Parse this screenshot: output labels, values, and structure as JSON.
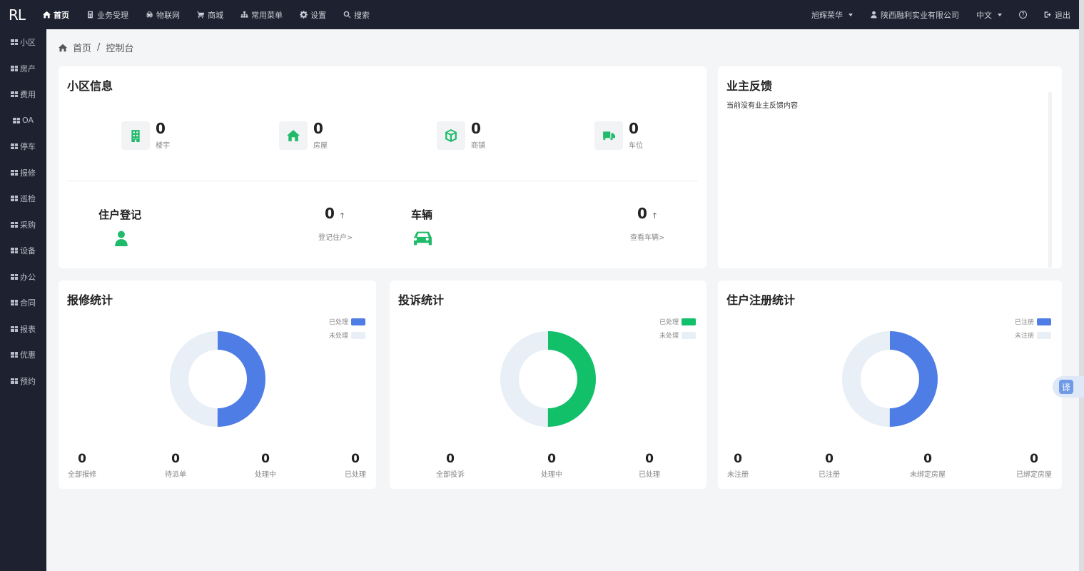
{
  "app": {
    "logo": "RL"
  },
  "topnav": {
    "items": [
      {
        "label": "首页",
        "icon": "home-icon",
        "active": true
      },
      {
        "label": "业务受理",
        "icon": "calculator-icon"
      },
      {
        "label": "物联网",
        "icon": "car-icon"
      },
      {
        "label": "商城",
        "icon": "cart-icon"
      },
      {
        "label": "常用菜单",
        "icon": "sitemap-icon"
      },
      {
        "label": "设置",
        "icon": "gear-icon"
      },
      {
        "label": "搜索",
        "icon": "search-icon"
      }
    ],
    "community": "旭辉荣华",
    "company": "陕西融利实业有限公司",
    "language": "中文",
    "help": "?",
    "logout": "退出"
  },
  "sidebar": {
    "items": [
      "小区",
      "房产",
      "费用",
      "OA",
      "停车",
      "报修",
      "巡检",
      "采购",
      "设备",
      "办公",
      "合同",
      "报表",
      "优惠",
      "预约"
    ]
  },
  "breadcrumb": {
    "home": "首页",
    "sep": "/",
    "current": "控制台"
  },
  "community_info": {
    "title": "小区信息",
    "stats": [
      {
        "value": "0",
        "label": "楼宇",
        "icon": "building-icon"
      },
      {
        "value": "0",
        "label": "房屋",
        "icon": "house-icon"
      },
      {
        "value": "0",
        "label": "商铺",
        "icon": "cube-icon"
      },
      {
        "value": "0",
        "label": "车位",
        "icon": "truck-icon"
      }
    ],
    "resident": {
      "title": "住户登记",
      "value": "0",
      "arrow": "↑",
      "link": "登记住户>"
    },
    "vehicle": {
      "title": "车辆",
      "value": "0",
      "arrow": "↑",
      "link": "查看车辆>"
    }
  },
  "feedback": {
    "title": "业主反馈",
    "empty_text": "当前没有业主反馈内容"
  },
  "colors": {
    "blue": "#4f7de6",
    "green": "#12c06a",
    "light": "#e9eff6",
    "sidebar": "#1e2230"
  },
  "repair": {
    "title": "报修统计",
    "legend": [
      "已处理",
      "未处理"
    ],
    "processed_fraction": 0.5,
    "stats": [
      {
        "value": "0",
        "label": "全部报修"
      },
      {
        "value": "0",
        "label": "待派单"
      },
      {
        "value": "0",
        "label": "处理中"
      },
      {
        "value": "0",
        "label": "已处理"
      }
    ]
  },
  "complaint": {
    "title": "投诉统计",
    "legend": [
      "已处理",
      "未处理"
    ],
    "processed_fraction": 0.5,
    "stats": [
      {
        "value": "0",
        "label": "全部投诉"
      },
      {
        "value": "0",
        "label": "处理中"
      },
      {
        "value": "0",
        "label": "已处理"
      }
    ]
  },
  "registration": {
    "title": "住户注册统计",
    "legend": [
      "已注册",
      "未注册"
    ],
    "registered_fraction": 0.5,
    "stats": [
      {
        "value": "0",
        "label": "未注册"
      },
      {
        "value": "0",
        "label": "已注册"
      },
      {
        "value": "0",
        "label": "未绑定房屋"
      },
      {
        "value": "0",
        "label": "已绑定房屋"
      }
    ]
  },
  "translate_button": "译"
}
